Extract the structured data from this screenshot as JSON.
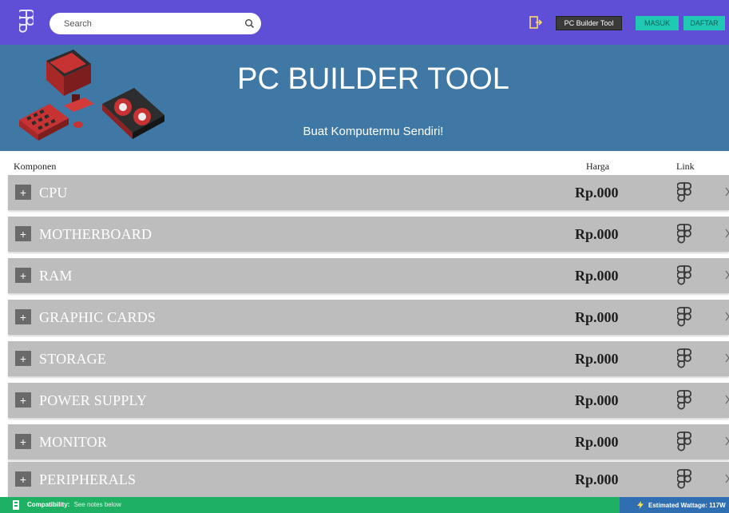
{
  "navbar": {
    "search_placeholder": "Search",
    "buttons": {
      "tool": "PC Builder Tool",
      "masuk": "MASUK",
      "daftar": "DAFTAR"
    }
  },
  "hero": {
    "title": "PC BUILDER TOOL",
    "subtitle": "Buat Komputermu Sendiri!"
  },
  "table": {
    "headers": {
      "komponen": "Komponen",
      "harga": "Harga",
      "link": "Link"
    },
    "rows": [
      {
        "label": "CPU",
        "price": "Rp.000"
      },
      {
        "label": "MOTHERBOARD",
        "price": "Rp.000"
      },
      {
        "label": "RAM",
        "price": "Rp.000"
      },
      {
        "label": "GRAPHIC CARDS",
        "price": "Rp.000"
      },
      {
        "label": "STORAGE",
        "price": "Rp.000"
      },
      {
        "label": "POWER SUPPLY",
        "price": "Rp.000"
      },
      {
        "label": "MONITOR",
        "price": "Rp.000"
      },
      {
        "label": "PERIPHERALS",
        "price": "Rp.000"
      }
    ]
  },
  "footer": {
    "compatibility_label": "Compatibility:",
    "compatibility_message": "See notes below",
    "wattage": "Estimated Wattage: 117W"
  },
  "colors": {
    "navbar": "#5e4fd6",
    "hero": "#3f78a5",
    "row": "#bdbdbd",
    "accent_button": "#1fc9b4",
    "footer": "#1fb163",
    "wattage": "#2f6eb0"
  },
  "icons": {
    "logo": "figma-logo-icon",
    "search": "search-icon",
    "exit": "sign-out-icon",
    "link": "figma-logo-icon",
    "expand": "plus-icon",
    "row_chevron": "chevron-right-icon",
    "bolt": "bolt-icon"
  }
}
